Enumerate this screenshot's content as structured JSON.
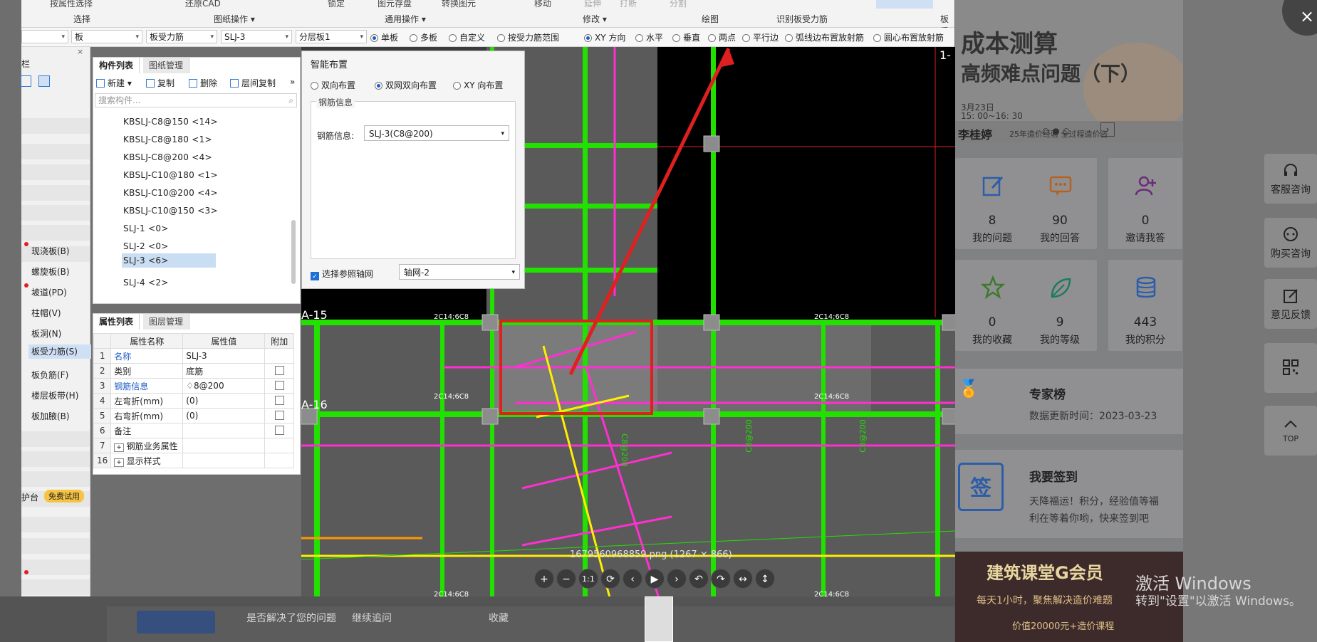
{
  "ribbon": {
    "groups": [
      "选择",
      "图纸操作",
      "通用操作",
      "修改",
      "绘图",
      "识别板受力筋",
      "板受"
    ],
    "top_items": [
      "按属性选择",
      "还原CAD",
      "锁定",
      "图元存盘",
      "转换图元",
      "移动",
      "延伸",
      "打断",
      "分割"
    ]
  },
  "toolbar": {
    "selects": [
      "",
      "板",
      "板受力筋",
      "SLJ-3",
      "分层板1"
    ],
    "options1": [
      "单板",
      "多板",
      "自定义",
      "按受力筋范围"
    ],
    "options2": [
      "XY 方向",
      "水平",
      "垂直",
      "两点",
      "平行边",
      "弧线边布置放射筋",
      "圆心布置放射筋"
    ]
  },
  "leftnav": {
    "items": [
      "现浇板(B)",
      "螺旋板(B)",
      "坡道(PD)",
      "柱帽(V)",
      "板洞(N)",
      "板受力筋(S)",
      "板负筋(F)",
      "楼层板带(H)",
      "板加腋(B)"
    ],
    "active": "板受力筋(S)",
    "promo_text": "护台",
    "promo_badge": "免费试用",
    "top_label": "栏"
  },
  "component_panel": {
    "tabs": [
      "构件列表",
      "图纸管理"
    ],
    "buttons": [
      "新建",
      "复制",
      "删除",
      "层间复制"
    ],
    "search_placeholder": "搜索构件...",
    "items": [
      "KBSLJ-C8@150 <14>",
      "KBSLJ-C8@180 <1>",
      "KBSLJ-C8@200 <4>",
      "KBSLJ-C10@180 <1>",
      "KBSLJ-C10@200 <4>",
      "KBSLJ-C10@150 <3>",
      "SLJ-1 <0>",
      "SLJ-2 <0>",
      "SLJ-3 <6>",
      "SLJ-4 <2>"
    ],
    "selected": "SLJ-3 <6>"
  },
  "property_panel": {
    "tabs": [
      "属性列表",
      "图层管理"
    ],
    "headers": [
      "属性名称",
      "属性值",
      "附加"
    ],
    "rows": [
      {
        "n": "1",
        "name": "名称",
        "value": "SLJ-3"
      },
      {
        "n": "2",
        "name": "类别",
        "value": "底筋"
      },
      {
        "n": "3",
        "name": "钢筋信息",
        "value": "♢8@200"
      },
      {
        "n": "4",
        "name": "左弯折(mm)",
        "value": "(0)"
      },
      {
        "n": "5",
        "name": "右弯折(mm)",
        "value": "(0)"
      },
      {
        "n": "6",
        "name": "备注",
        "value": ""
      },
      {
        "n": "7",
        "name": "钢筋业务属性",
        "value": ""
      },
      {
        "n": "16",
        "name": "显示样式",
        "value": ""
      }
    ]
  },
  "dialog": {
    "title": "智能布置",
    "modes": [
      "双向布置",
      "双网双向布置",
      "XY 向布置"
    ],
    "selected_mode": "双网双向布置",
    "group_label": "钢筋信息",
    "rebar_label": "钢筋信息:",
    "rebar_value": "SLJ-3(C8@200)",
    "axis_check_label": "选择参照轴网",
    "axis_value": "轴网-2"
  },
  "drawing": {
    "axis_labels": [
      "A-15",
      "A-16",
      "1-"
    ],
    "rebar_tags": [
      "2C14;6C8",
      "C8@200"
    ],
    "filename": "1679560968859.png (1267 × 866)"
  },
  "viewer_tools": [
    "+",
    "−",
    "1:1",
    "⟳",
    "‹",
    "▶",
    "›",
    "↶",
    "↷",
    "↔",
    "↕"
  ],
  "bottom": {
    "text1": "是否解决了您的问题",
    "text2": "继续追问",
    "text3": "收藏"
  },
  "right": {
    "banner_title": "成本测算",
    "banner_subtitle": "高频难点问题（下）",
    "banner_date": "3月23日",
    "banner_time": "15: 00~16: 30",
    "banner_speaker": "李桂婷",
    "banner_speaker_desc": "25年造价经验 全过程造价咨",
    "stats": [
      {
        "num": "8",
        "label": "我的问题"
      },
      {
        "num": "90",
        "label": "我的回答"
      },
      {
        "num": "0",
        "label": "邀请我答"
      },
      {
        "num": "0",
        "label": "我的收藏"
      },
      {
        "num": "9",
        "label": "我的等级"
      },
      {
        "num": "443",
        "label": "我的积分"
      }
    ],
    "expert_title": "专家榜",
    "expert_sub": "数据更新时间：2023-03-23",
    "sign_title": "我要签到",
    "sign_icon": "签",
    "sign_desc1": "天降福运！积分，经验值等福",
    "sign_desc2": "利在等着你哟，快来签到吧",
    "vip_title": "建筑课堂G会员",
    "vip_sub": "每天1小时，聚焦解决造价难题",
    "vip_price": "价值20000元+造价课程"
  },
  "side_buttons": [
    "客服咨询",
    "购买咨询",
    "意见反馈",
    "",
    "TOP"
  ],
  "windows": {
    "activate": "激活 Windows",
    "activate_sub": "转到\"设置\"以激活 Windows。"
  },
  "colors": {
    "green": "#22e000",
    "magenta": "#ff2fd0",
    "yellow": "#ffee00",
    "red": "#e02020",
    "cyan": "#00c8c8"
  }
}
